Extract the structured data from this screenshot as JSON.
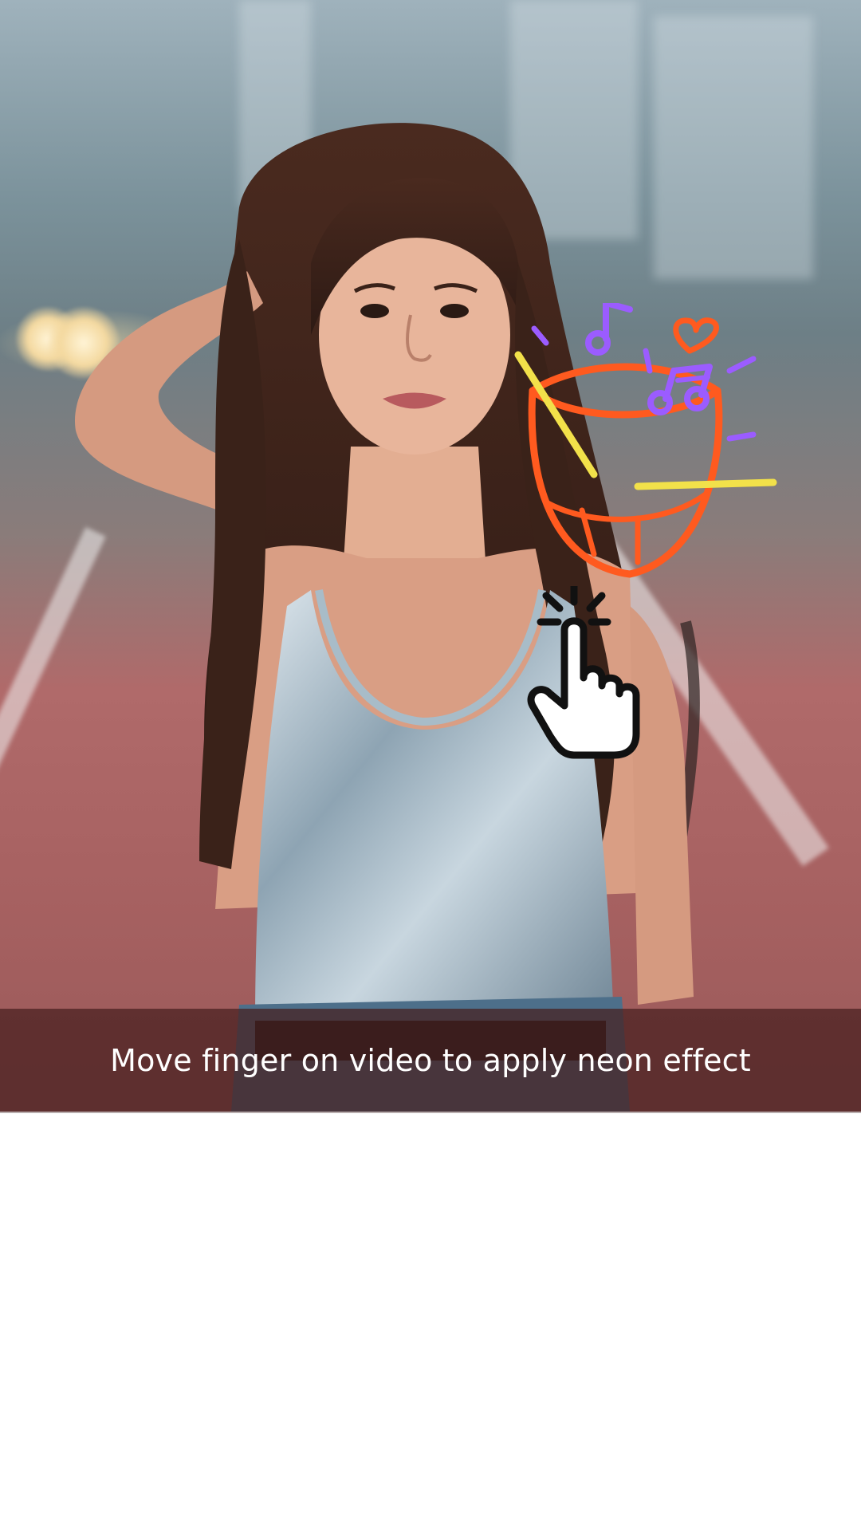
{
  "video": {
    "instruction": "Move finger on video to apply neon effect"
  },
  "icons": {
    "tap_hint": "tap-hand-icon",
    "neon_sticker": "neon-drum-music-icon"
  },
  "colors": {
    "banner_bg": "#461e1e",
    "neon_orange": "#ff5a1f",
    "neon_yellow": "#f2e14a",
    "neon_purple": "#9b5cff",
    "page_bg": "#ffffff"
  }
}
